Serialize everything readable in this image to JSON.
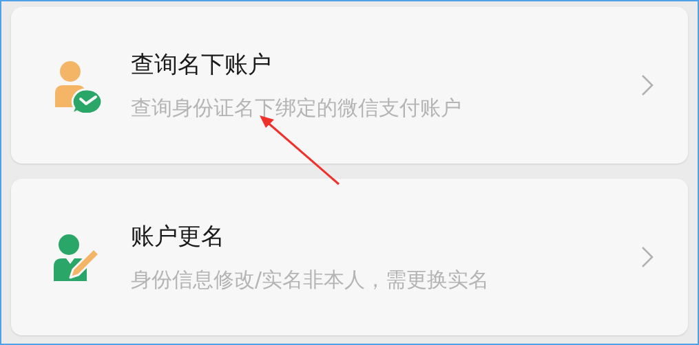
{
  "items": [
    {
      "title": "查询名下账户",
      "subtitle": "查询身份证名下绑定的微信支付账户"
    },
    {
      "title": "账户更名",
      "subtitle": "身份信息修改/实名非本人，需更换实名"
    }
  ]
}
